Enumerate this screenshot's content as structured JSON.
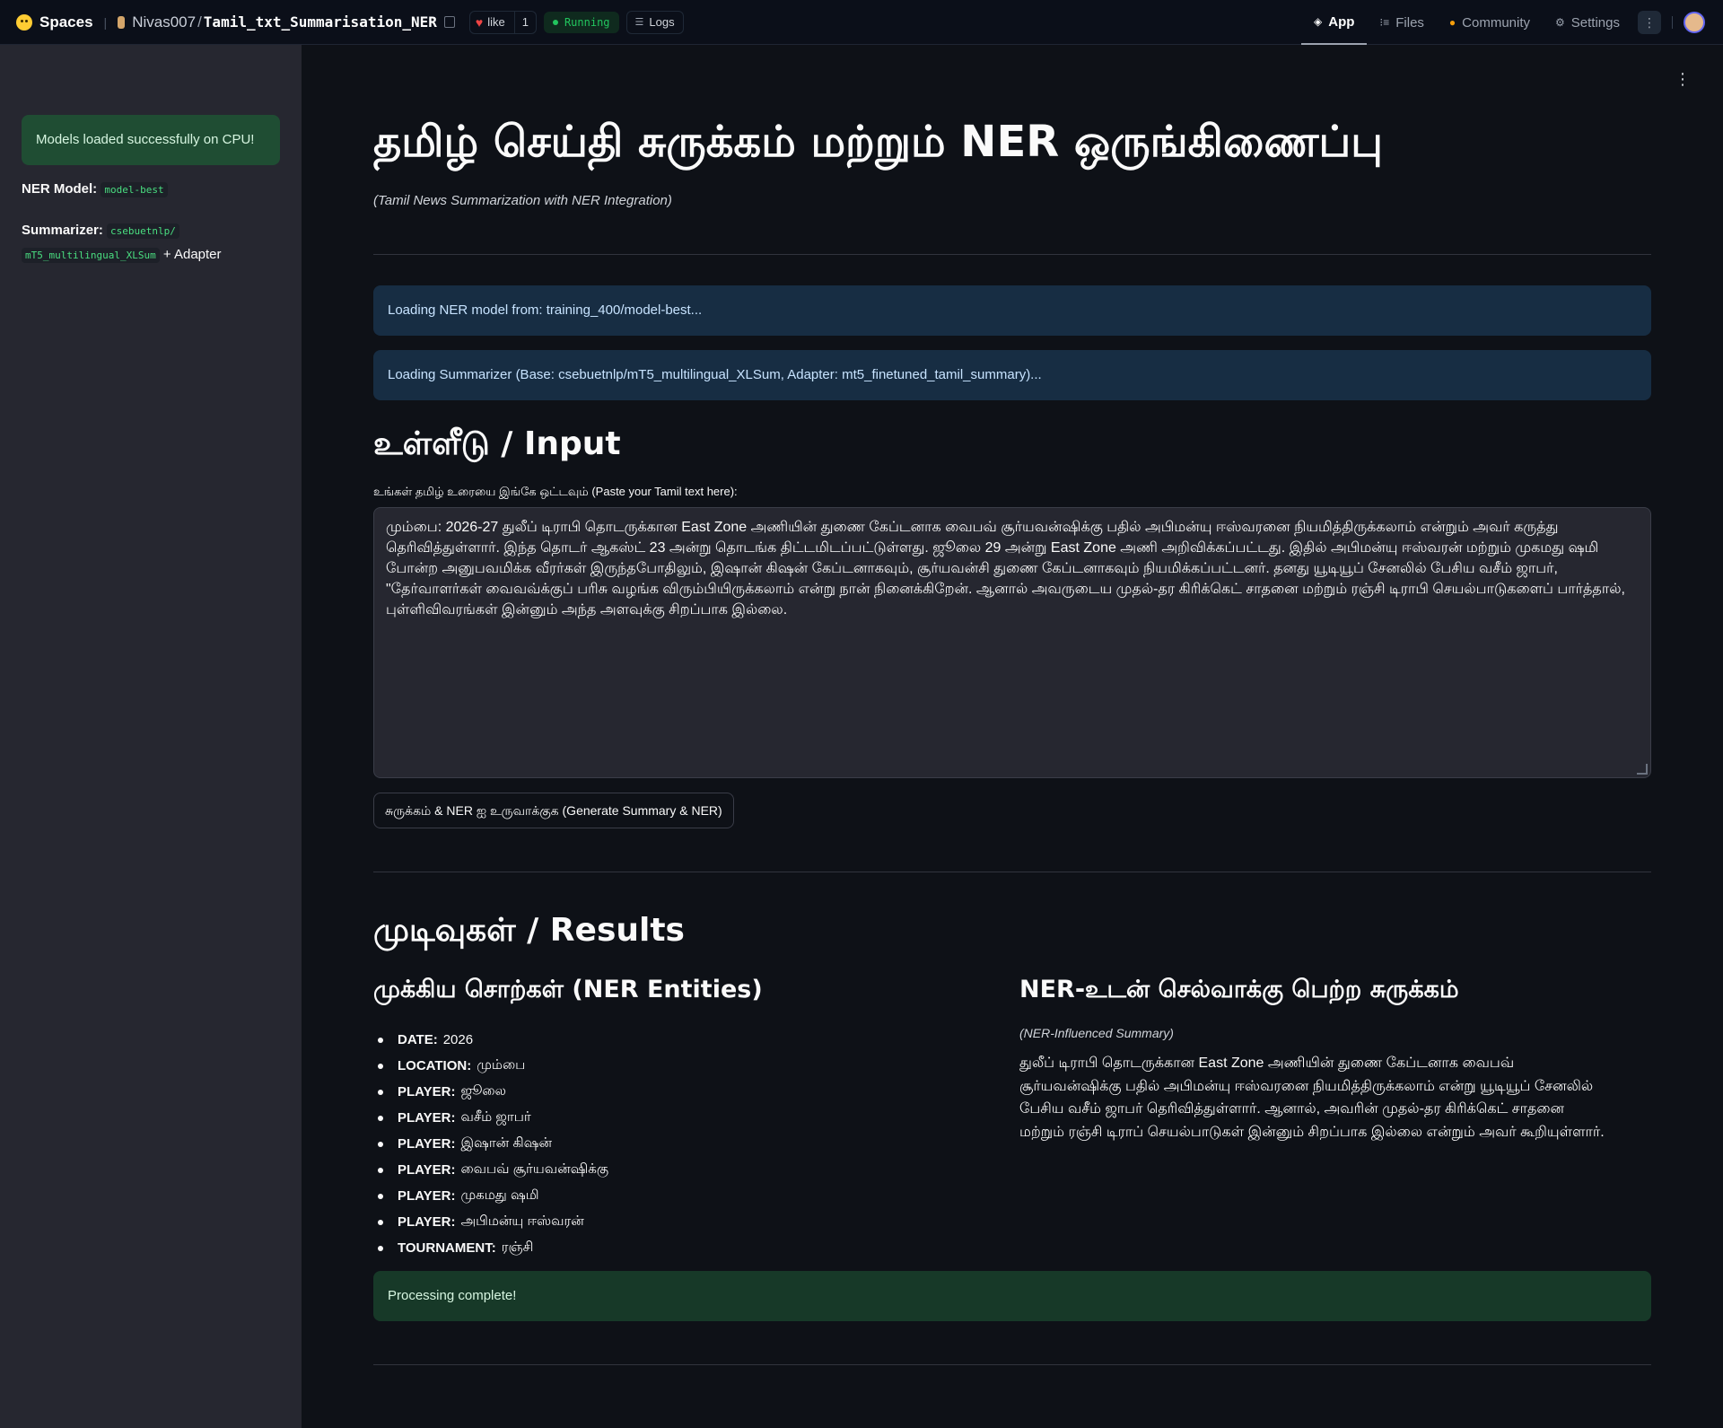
{
  "topbar": {
    "spaces_label": "Spaces",
    "repo_owner": "Nivas007",
    "repo_separator": "/",
    "repo_name": "Tamil_txt_Summarisation_NER",
    "like_label": "like",
    "like_count": "1",
    "status": "Running",
    "logs_label": "Logs",
    "nav": [
      {
        "label": "App",
        "icon": "app-cube-icon",
        "active": true
      },
      {
        "label": "Files",
        "icon": "files-icon"
      },
      {
        "label": "Community",
        "icon": "community-icon"
      },
      {
        "label": "Settings",
        "icon": "gear-icon"
      }
    ]
  },
  "sidebar": {
    "success_message": "Models loaded successfully on CPU!",
    "ner_model_label": "NER Model:",
    "ner_model_value": "model-best",
    "summarizer_label": "Summarizer:",
    "summarizer_value_line1": "csebuetnlp/",
    "summarizer_value_line2": "mT5_multilingual_XLSum",
    "summarizer_suffix": "+ Adapter"
  },
  "main": {
    "title": "தமிழ் செய்தி சுருக்கம் மற்றும் NER ஒருங்கிணைப்பு",
    "subtitle": "(Tamil News Summarization with NER Integration)",
    "info_messages": [
      "Loading NER model from: training_400/model-best...",
      "Loading Summarizer (Base: csebuetnlp/mT5_multilingual_XLSum, Adapter: mt5_finetuned_tamil_summary)..."
    ],
    "input_heading": "உள்ளீடு / Input",
    "input_label": "உங்கள் தமிழ் உரையை இங்கே ஒட்டவும் (Paste your Tamil text here):",
    "input_text": "மும்பை: 2026-27 துலீப் டிராபி தொடருக்கான East Zone அணியின் துணை கேப்டனாக வைபவ் சூர்யவன்ஷிக்கு பதில் அபிமன்யு ஈஸ்வரனை நியமித்திருக்கலாம் என்றும் அவர் கருத்து தெரிவித்துள்ளார். இந்த தொடர் ஆகஸ்ட் 23 அன்று தொடங்க திட்டமிடப்பட்டுள்ளது. ஜூலை 29 அன்று East Zone அணி அறிவிக்கப்பட்டது. இதில் அபிமன்யு ஈஸ்வரன் மற்றும் முகமது ஷமி போன்ற அனுபவமிக்க வீரர்கள் இருந்தபோதிலும், இஷான் கிஷன் கேப்டனாகவும், சூர்யவன்சி துணை கேப்டனாகவும் நியமிக்கப்பட்டனர். தனது யூடியூப் சேனலில் பேசிய வசீம் ஜாபர், \"தேர்வாளர்கள் வைவவ்க்குப் பரிசு வழங்க விரும்பியிருக்கலாம் என்று நான் நினைக்கிறேன். ஆனால் அவருடைய முதல்-தர கிரிக்கெட் சாதனை மற்றும் ரஞ்சி டிராபி செயல்பாடுகளைப் பார்த்தால், புள்ளிவிவரங்கள் இன்னும் அந்த அளவுக்கு சிறப்பாக இல்லை.",
    "generate_button": "சுருக்கம் & NER ஐ உருவாக்குக (Generate Summary & NER)",
    "results_heading": "முடிவுகள் / Results",
    "entities_heading": "முக்கிய சொற்கள் (NER Entities)",
    "entities": [
      {
        "type": "DATE:",
        "value": "2026"
      },
      {
        "type": "LOCATION:",
        "value": "மும்பை"
      },
      {
        "type": "PLAYER:",
        "value": "ஜூலை"
      },
      {
        "type": "PLAYER:",
        "value": "வசீம் ஜாபர்"
      },
      {
        "type": "PLAYER:",
        "value": "இஷான் கிஷன்"
      },
      {
        "type": "PLAYER:",
        "value": "வைபவ் சூர்யவன்ஷிக்கு"
      },
      {
        "type": "PLAYER:",
        "value": "முகமது ஷமி"
      },
      {
        "type": "PLAYER:",
        "value": "அபிமன்யு ஈஸ்வரன்"
      },
      {
        "type": "TOURNAMENT:",
        "value": "ரஞ்சி"
      }
    ],
    "summary_heading": "NER-உடன் செல்வாக்கு பெற்ற சுருக்கம்",
    "summary_note": "(NER-Influenced Summary)",
    "summary_text": "துலீப் டிராபி தொடருக்கான East Zone அணியின் துணை கேப்டனாக வைபவ் சூர்யவன்ஷிக்கு பதில் அபிமன்யு ஈஸ்வரனை நியமித்திருக்கலாம் என்று யூடியூப் சேனலில் பேசிய வசீம் ஜாபர் தெரிவித்துள்ளார். ஆனால், அவரின் முதல்-தர கிரிக்கெட் சாதனை மற்றும் ரஞ்சி டிராப் செயல்பாடுகள் இன்னும் சிறப்பாக இல்லை என்றும் அவர் கூறியுள்ளார்.",
    "complete_message": "Processing complete!"
  }
}
